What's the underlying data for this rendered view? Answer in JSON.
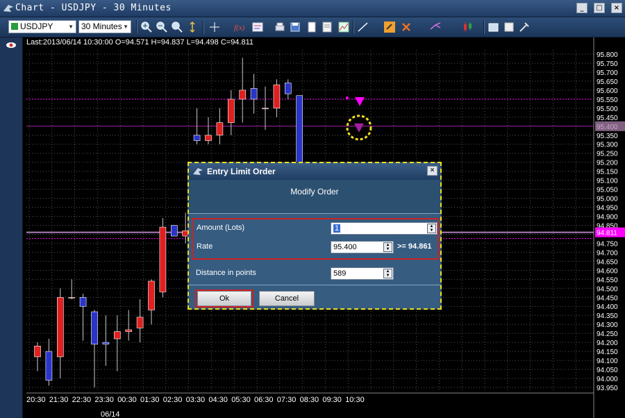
{
  "window": {
    "title": "Chart - USDJPY - 30 Minutes"
  },
  "toolbar": {
    "symbol": "USDJPY",
    "timeframe": "30 Minutes"
  },
  "last_info": "Last:2013/06/14 10:30:00 O=94.571 H=94.837 L=94.498 C=94.811",
  "colors": {
    "up": "#e02020",
    "down": "#2a35c8",
    "grid": "#555555",
    "magenta": "#ff00ff",
    "current_price_bg": "#ff00ff"
  },
  "chart_data": {
    "type": "candlestick",
    "x_labels": [
      "20:30",
      "21:30",
      "22:30",
      "23:30",
      "00:30",
      "01:30",
      "02:30",
      "03:30",
      "04:30",
      "05:30",
      "06:30",
      "07:30",
      "08:30",
      "09:30",
      "10:30"
    ],
    "date_label": "06/14",
    "y_ticks": [
      "95.800",
      "95.750",
      "95.700",
      "95.650",
      "95.600",
      "95.550",
      "95.500",
      "95.450",
      "95.400",
      "95.350",
      "95.300",
      "95.250",
      "95.200",
      "95.150",
      "95.100",
      "95.050",
      "95.000",
      "94.950",
      "94.900",
      "94.850",
      "94.800",
      "94.750",
      "94.700",
      "94.650",
      "94.600",
      "94.550",
      "94.500",
      "94.450",
      "94.400",
      "94.350",
      "94.300",
      "94.250",
      "94.200",
      "94.150",
      "94.100",
      "94.050",
      "94.000",
      "93.950"
    ],
    "ylim": [
      93.95,
      95.8
    ],
    "current_price": "94.811",
    "order_rate_label": "95.400",
    "limit_line": 95.55,
    "order_line": 95.4,
    "candles": [
      {
        "o": 94.12,
        "h": 94.2,
        "l": 94.04,
        "c": 94.18
      },
      {
        "o": 94.15,
        "h": 94.22,
        "l": 93.96,
        "c": 93.99
      },
      {
        "o": 94.12,
        "h": 94.5,
        "l": 94.0,
        "c": 94.45
      },
      {
        "o": 94.45,
        "h": 94.55,
        "l": 94.44,
        "c": 94.45
      },
      {
        "o": 94.45,
        "h": 94.47,
        "l": 94.21,
        "c": 94.4
      },
      {
        "o": 94.37,
        "h": 94.38,
        "l": 93.95,
        "c": 94.19
      },
      {
        "o": 94.2,
        "h": 94.35,
        "l": 94.07,
        "c": 94.19
      },
      {
        "o": 94.22,
        "h": 94.35,
        "l": 94.04,
        "c": 94.26
      },
      {
        "o": 94.26,
        "h": 94.38,
        "l": 94.21,
        "c": 94.27
      },
      {
        "o": 94.28,
        "h": 94.44,
        "l": 94.2,
        "c": 94.34
      },
      {
        "o": 94.38,
        "h": 94.55,
        "l": 94.3,
        "c": 94.54
      },
      {
        "o": 94.48,
        "h": 94.89,
        "l": 94.45,
        "c": 94.84
      },
      {
        "o": 94.85,
        "h": 94.85,
        "l": 94.85,
        "c": 94.79
      },
      {
        "o": 94.79,
        "h": 94.92,
        "l": 94.75,
        "c": 94.82
      },
      {
        "o": 95.35,
        "h": 95.5,
        "l": 95.3,
        "c": 95.32
      },
      {
        "o": 95.32,
        "h": 95.45,
        "l": 95.3,
        "c": 95.35
      },
      {
        "o": 95.35,
        "h": 95.5,
        "l": 95.3,
        "c": 95.42
      },
      {
        "o": 95.42,
        "h": 95.6,
        "l": 95.35,
        "c": 95.55
      },
      {
        "o": 95.55,
        "h": 95.78,
        "l": 95.42,
        "c": 95.6
      },
      {
        "o": 95.61,
        "h": 95.69,
        "l": 95.47,
        "c": 95.55
      },
      {
        "o": 95.5,
        "h": 95.62,
        "l": 95.38,
        "c": 95.5
      },
      {
        "o": 95.5,
        "h": 95.66,
        "l": 95.45,
        "c": 95.63
      },
      {
        "o": 95.64,
        "h": 95.66,
        "l": 95.55,
        "c": 95.58
      },
      {
        "o": 95.57,
        "h": 95.57,
        "l": 95.2,
        "c": 95.2
      }
    ]
  },
  "dialog": {
    "title": "Entry Limit Order",
    "header": "Modify Order",
    "amount_label": "Amount (Lots)",
    "amount_value": "1",
    "rate_label": "Rate",
    "rate_value": "95.400",
    "rate_constraint": ">= 94.861",
    "distance_label": "Distance in points",
    "distance_value": "589",
    "ok_label": "Ok",
    "cancel_label": "Cancel"
  }
}
